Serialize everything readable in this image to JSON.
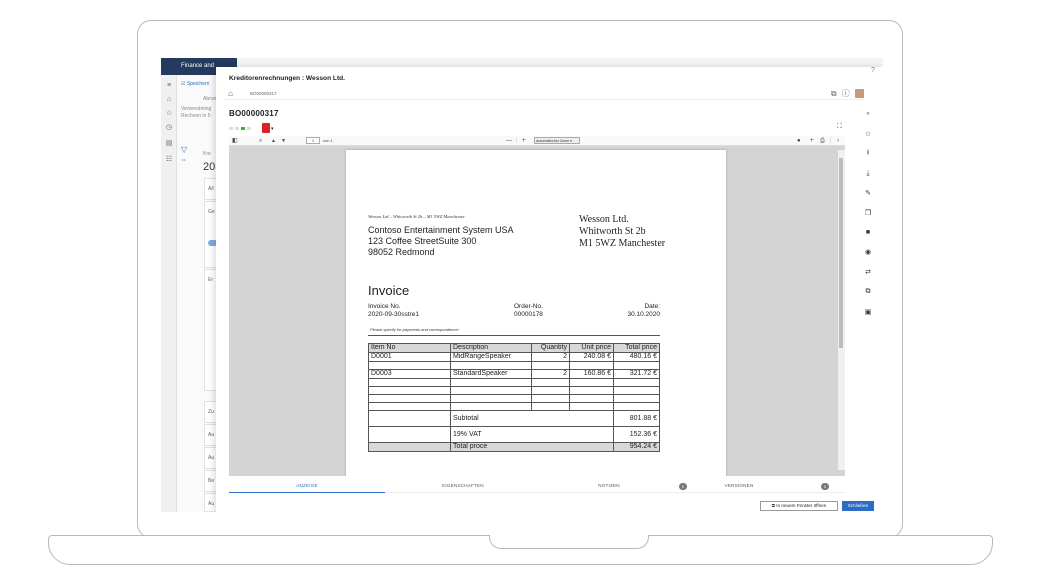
{
  "app": {
    "bar_title": "Finance and",
    "background": {
      "toolbar_save": "Speichern",
      "line1": "Abrunk",
      "line2": "Verwendeting",
      "line3": "Rechnen in 5:",
      "filter_label": "Kre",
      "year": "20",
      "cards": [
        "All",
        "Ge",
        "Er",
        "Zu",
        "Au",
        "Au",
        "Be",
        "Au",
        "Fü"
      ]
    }
  },
  "panel": {
    "title": "Kreditorenrechnungen : Wesson Ltd.",
    "help": "?",
    "breadcrumb": "BO00000317",
    "doc_title": "BO00000317",
    "toolbar": {
      "page_value": "1",
      "page_of": "von 1",
      "zoom_label": "Automatischer Zoom"
    },
    "tabs": [
      {
        "label": "ANZEIGE"
      },
      {
        "label": "EIGENSCHAFTEN"
      },
      {
        "label": "NOTIZEN",
        "badge": "0"
      },
      {
        "label": "VERSIONEN",
        "badge": "0"
      }
    ],
    "buttons": {
      "open_new": "In neuem Fenster öffnen",
      "close": "Schließen"
    }
  },
  "invoice": {
    "sender_line": "Wesson Ltd – Whitworth St 2b – M1 5WZ Manchester",
    "recipient": [
      "Contoso Entertainment System USA",
      "123 Coffee StreetSuite 300",
      "98052 Redmond"
    ],
    "company": [
      "Wesson Ltd.",
      "Whitworth St 2b",
      "M1 5WZ Manchester"
    ],
    "title": "Invoice",
    "invoice_no_label": "Invoice No.",
    "invoice_no": "2020-09-30sstre1",
    "order_no_label": "Order-No.",
    "order_no": "00000178",
    "date_label": "Date:",
    "date": "30.10.2020",
    "note": "Please specify for payments and correspondence!",
    "headers": [
      "Item No",
      "Description",
      "Quantity",
      "Unit price",
      "Total price"
    ],
    "rows": [
      [
        "D0001",
        "MidRangeSpeaker",
        "2",
        "240.08 €",
        "480.16 €"
      ],
      [
        "D0003",
        "StandardSpeaker",
        "2",
        "160.86 €",
        "321.72 €"
      ]
    ],
    "subtotal_label": "Subtotal",
    "subtotal": "801.88 €",
    "vat_label": "19% VAT",
    "vat": "152.36 €",
    "total_label": "Total proce",
    "total": "954.24 €"
  }
}
